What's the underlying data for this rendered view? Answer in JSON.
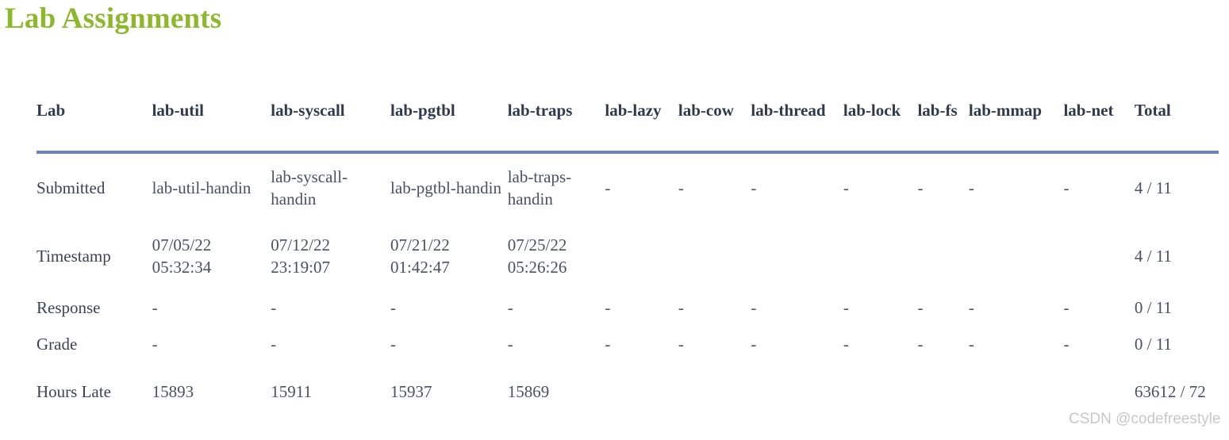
{
  "page": {
    "title": "Lab Assignments",
    "title_color": "#8CB82B",
    "header_rule_color": "#7083B5",
    "background": "#ffffff",
    "header_text_color": "#2F3A4F",
    "body_text_color": "#4A5160"
  },
  "table": {
    "columns": [
      "Lab",
      "lab-util",
      "lab-syscall",
      "lab-pgtbl",
      "lab-traps",
      "lab-lazy",
      "lab-cow",
      "lab-thread",
      "lab-lock",
      "lab-fs",
      "lab-mmap",
      "lab-net",
      "Total"
    ],
    "rows": [
      {
        "label": "Submitted",
        "cells": [
          "lab-util-handin",
          "lab-syscall-handin",
          "lab-pgtbl-handin",
          "lab-traps-handin",
          "-",
          "-",
          "-",
          "-",
          "-",
          "-",
          "-"
        ],
        "total": "4 / 11"
      },
      {
        "label": "Timestamp",
        "cells": [
          "07/05/22 05:32:34",
          "07/12/22 23:19:07",
          "07/21/22 01:42:47",
          "07/25/22 05:26:26",
          "",
          "",
          "",
          "",
          "",
          "",
          ""
        ],
        "total": "4 / 11"
      },
      {
        "label": "Response",
        "cells": [
          "-",
          "-",
          "-",
          "-",
          "-",
          "-",
          "-",
          "-",
          "-",
          "-",
          "-"
        ],
        "total": "0 / 11"
      },
      {
        "label": "Grade",
        "cells": [
          "-",
          "-",
          "-",
          "-",
          "-",
          "-",
          "-",
          "-",
          "-",
          "-",
          "-"
        ],
        "total": "0 / 11"
      },
      {
        "label": "Hours Late",
        "cells": [
          "15893",
          "15911",
          "15937",
          "15869",
          "",
          "",
          "",
          "",
          "",
          "",
          ""
        ],
        "total": "63612 / 72"
      }
    ]
  },
  "watermark": {
    "text": "CSDN @codefreestyle"
  }
}
